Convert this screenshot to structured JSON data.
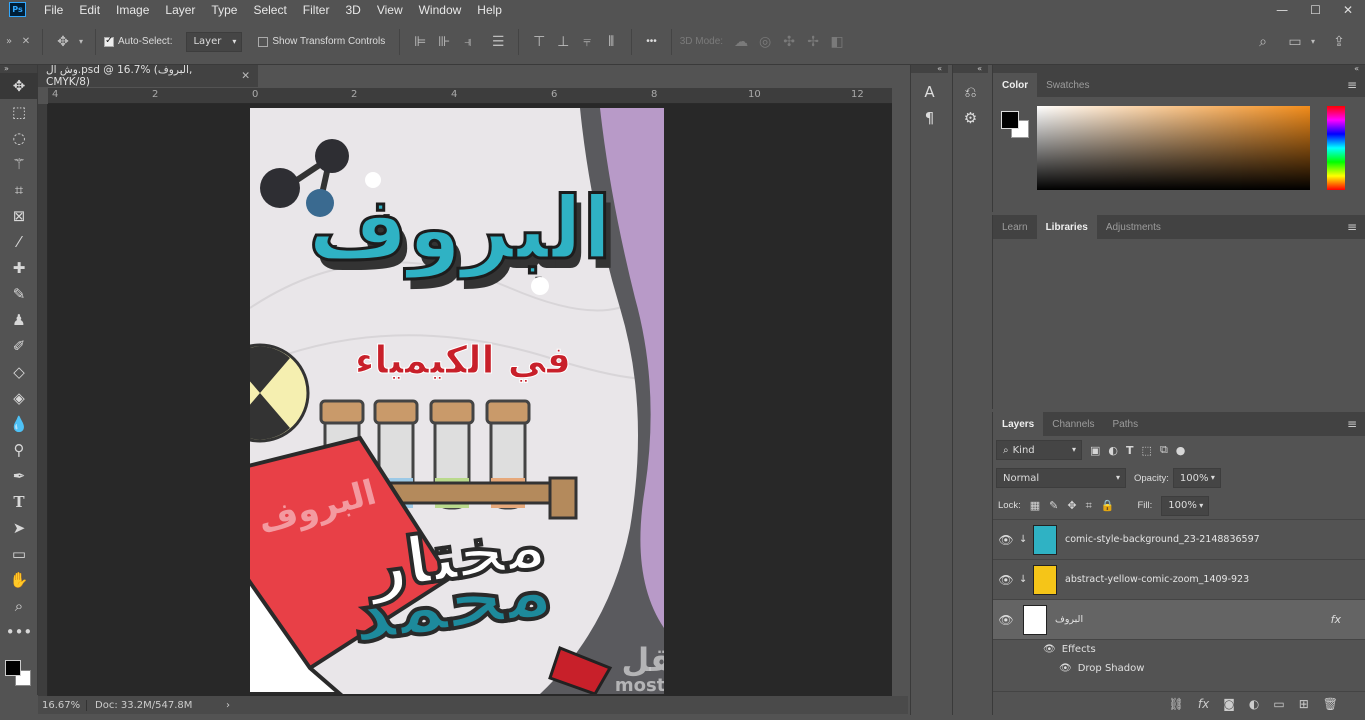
{
  "app": {
    "logo": "Ps"
  },
  "menu": [
    "File",
    "Edit",
    "Image",
    "Layer",
    "Type",
    "Select",
    "Filter",
    "3D",
    "View",
    "Window",
    "Help"
  ],
  "window_controls": [
    "—",
    "☐",
    "✕"
  ],
  "options": {
    "auto_select_label": "Auto-Select:",
    "auto_select_value": "Layer",
    "transform_label": "Show Transform Controls",
    "mode_3d_label": "3D Mode:",
    "more": "•••"
  },
  "document": {
    "tab_title": "وش ال.psd @ 16.7% (البروف, CMYK/8)",
    "close": "✕",
    "ruler_ticks": [
      "4",
      "2",
      "0",
      "2",
      "4",
      "6",
      "8",
      "10",
      "12"
    ],
    "zoom": "16.67%",
    "doc_size": "Doc: 33.2M/547.8M"
  },
  "artwork": {
    "title": "البروف",
    "subtitle": "في الكيمياء",
    "book_label": "البروف",
    "name_line1": "مختار",
    "name_line2": "محمد",
    "watermark_ar": "مستقل",
    "watermark_en": "mostaql.com"
  },
  "panels": {
    "color_tabs": [
      "Color",
      "Swatches"
    ],
    "library_tabs": [
      "Learn",
      "Libraries",
      "Adjustments"
    ],
    "layer_tabs": [
      "Layers",
      "Channels",
      "Paths"
    ],
    "kind_label": "Kind",
    "blend_mode": "Normal",
    "opacity_label": "Opacity:",
    "opacity_value": "100%",
    "lock_label": "Lock:",
    "fill_label": "Fill:",
    "fill_value": "100%",
    "collapse": "«",
    "menu_icon": "≡"
  },
  "layers": [
    {
      "name": "comic-style-background_23-2148836597",
      "thumb_color": "#2fb2c4"
    },
    {
      "name": "abstract-yellow-comic-zoom_1409-923",
      "thumb_color": "#f5c518"
    },
    {
      "name": "البروف",
      "thumb_color": "#ffffff",
      "fx": "fx"
    }
  ],
  "effects": {
    "label": "Effects",
    "drop_shadow": "Drop Shadow"
  },
  "colors": {
    "accent_teal": "#2fb2c4",
    "red_title": "#c8202a",
    "panel_bg": "#535353"
  }
}
